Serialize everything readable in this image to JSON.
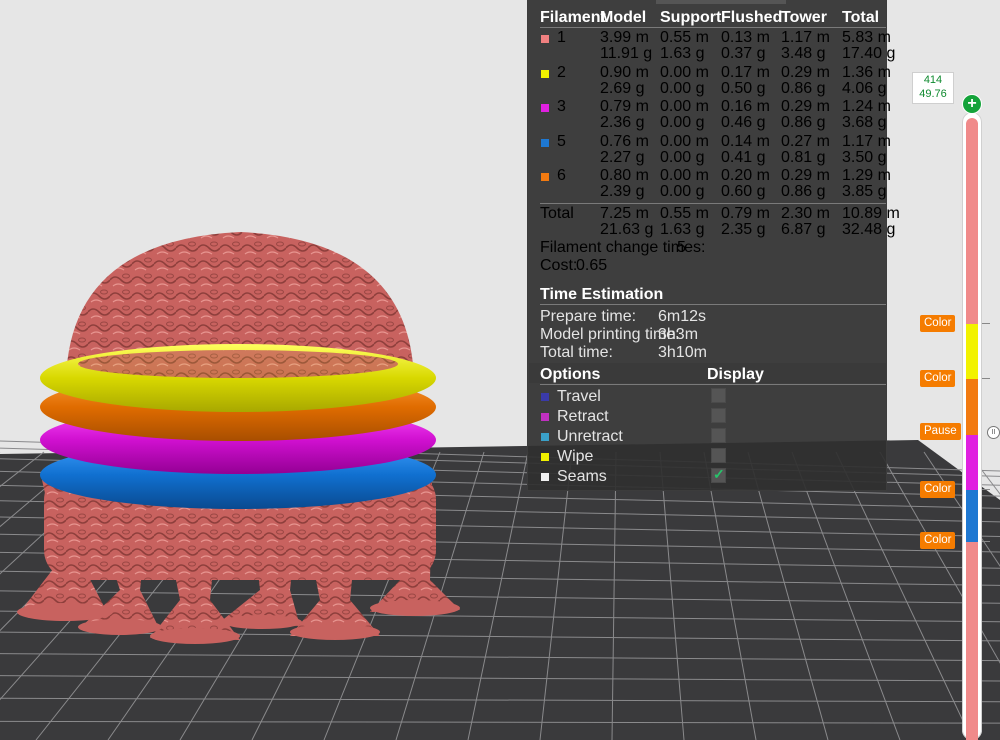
{
  "stats": {
    "headers": [
      "Filament",
      "Model",
      "Support",
      "Flushed",
      "Tower",
      "Total"
    ],
    "filaments": [
      {
        "id": "1",
        "color": "#f08080",
        "model": [
          "3.99 m",
          "11.91 g"
        ],
        "support": [
          "0.55 m",
          "1.63 g"
        ],
        "flushed": [
          "0.13 m",
          "0.37 g"
        ],
        "tower": [
          "1.17 m",
          "3.48 g"
        ],
        "total": [
          "5.83 m",
          "17.40 g"
        ]
      },
      {
        "id": "2",
        "color": "#f2f200",
        "model": [
          "0.90 m",
          "2.69 g"
        ],
        "support": [
          "0.00 m",
          "0.00 g"
        ],
        "flushed": [
          "0.17 m",
          "0.50 g"
        ],
        "tower": [
          "0.29 m",
          "0.86 g"
        ],
        "total": [
          "1.36 m",
          "4.06 g"
        ]
      },
      {
        "id": "3",
        "color": "#e020e0",
        "model": [
          "0.79 m",
          "2.36 g"
        ],
        "support": [
          "0.00 m",
          "0.00 g"
        ],
        "flushed": [
          "0.16 m",
          "0.46 g"
        ],
        "tower": [
          "0.29 m",
          "0.86 g"
        ],
        "total": [
          "1.24 m",
          "3.68 g"
        ]
      },
      {
        "id": "5",
        "color": "#1e78d2",
        "model": [
          "0.76 m",
          "2.27 g"
        ],
        "support": [
          "0.00 m",
          "0.00 g"
        ],
        "flushed": [
          "0.14 m",
          "0.41 g"
        ],
        "tower": [
          "0.27 m",
          "0.81 g"
        ],
        "total": [
          "1.17 m",
          "3.50 g"
        ]
      },
      {
        "id": "6",
        "color": "#f27a10",
        "model": [
          "0.80 m",
          "2.39 g"
        ],
        "support": [
          "0.00 m",
          "0.00 g"
        ],
        "flushed": [
          "0.20 m",
          "0.60 g"
        ],
        "tower": [
          "0.29 m",
          "0.86 g"
        ],
        "total": [
          "1.29 m",
          "3.85 g"
        ]
      }
    ],
    "total_label": "Total",
    "total": {
      "model": [
        "7.25 m",
        "21.63 g"
      ],
      "support": [
        "0.55 m",
        "1.63 g"
      ],
      "flushed": [
        "0.79 m",
        "2.35 g"
      ],
      "tower": [
        "2.30 m",
        "6.87 g"
      ],
      "total": [
        "10.89 m",
        "32.48 g"
      ]
    },
    "filament_change_label": "Filament change times:",
    "filament_change_value": "5",
    "cost_label": "Cost:",
    "cost_value": "0.65"
  },
  "time": {
    "title": "Time Estimation",
    "rows": [
      {
        "label": "Prepare time:",
        "value": "6m12s"
      },
      {
        "label": "Model printing time:",
        "value": "3h3m"
      },
      {
        "label": "Total time:",
        "value": "3h10m"
      }
    ]
  },
  "options": {
    "title": "Options",
    "display_title": "Display",
    "items": [
      {
        "label": "Travel",
        "color": "#3a3aa8",
        "checked": false
      },
      {
        "label": "Retract",
        "color": "#c030c0",
        "checked": false
      },
      {
        "label": "Unretract",
        "color": "#3aa0c8",
        "checked": false
      },
      {
        "label": "Wipe",
        "color": "#f0f000",
        "checked": false
      },
      {
        "label": "Seams",
        "color": "#f0f0f0",
        "checked": true
      }
    ]
  },
  "slider": {
    "top_layer": "414",
    "top_height": "49.76",
    "markers": [
      {
        "label": "Color"
      },
      {
        "label": "Color"
      },
      {
        "label": "Pause"
      },
      {
        "label": "Color"
      },
      {
        "label": "Color"
      }
    ]
  }
}
